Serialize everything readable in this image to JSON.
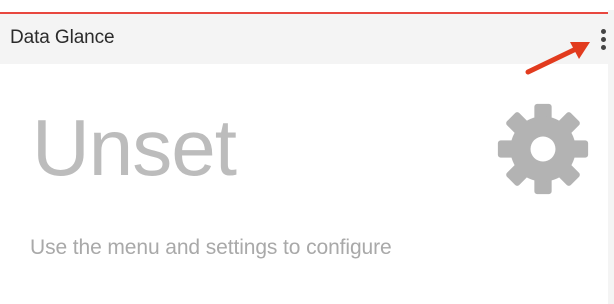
{
  "widget": {
    "title": "Data Glance",
    "accent_color": "#e8473f",
    "menu_icon": "kebab-menu-icon",
    "status": "Unset",
    "settings_icon": "gear-icon",
    "instruction": "Use the menu and settings to configure",
    "annotation_icon": "red-arrow-icon"
  }
}
